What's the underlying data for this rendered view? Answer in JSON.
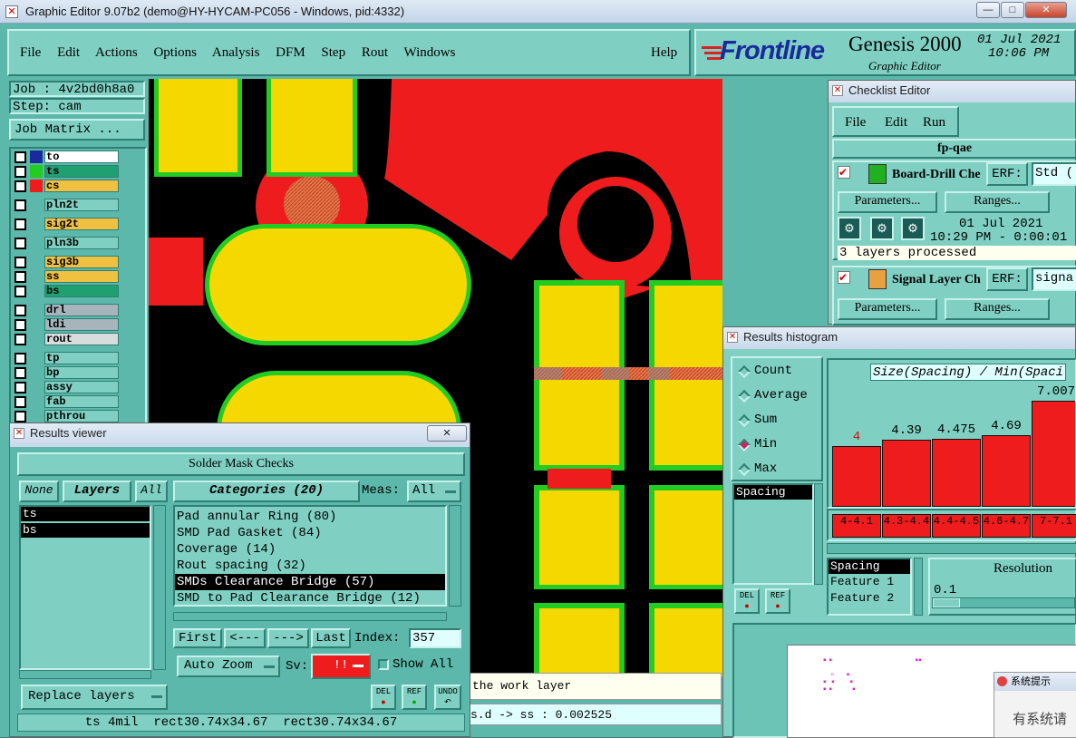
{
  "window": {
    "title": "Graphic Editor 9.07b2 (demo@HY-HYCAM-PC056 - Windows, pid:4332)",
    "minimize": "—",
    "maximize": "□",
    "close": "✕"
  },
  "menubar": {
    "file": "File",
    "edit": "Edit",
    "actions": "Actions",
    "options": "Options",
    "analysis": "Analysis",
    "dfm": "DFM",
    "step": "Step",
    "rout": "Rout",
    "windows": "Windows",
    "help": "Help"
  },
  "brand": {
    "logo": "Frontline",
    "product": "Genesis 2000",
    "subtitle": "Graphic Editor",
    "date": "01 Jul 2021",
    "time": "10:06 PM"
  },
  "job": {
    "job_label": "Job : 4v2bd0h8a0",
    "step_label": "Step: cam",
    "matrix_button": "Job Matrix ..."
  },
  "layers": [
    {
      "name": "to",
      "color": "#ffffff"
    },
    {
      "name": "ts",
      "color": "#20a070"
    },
    {
      "name": "cs",
      "color": "#f0c040"
    },
    {
      "name": "pln2t",
      "color": "#7fd0c3"
    },
    {
      "name": "sig2t",
      "color": "#f0c040"
    },
    {
      "name": "pln3b",
      "color": "#7fd0c3"
    },
    {
      "name": "sig3b",
      "color": "#f0c040"
    },
    {
      "name": "ss",
      "color": "#f0c040"
    },
    {
      "name": "bs",
      "color": "#20a070"
    },
    {
      "name": "drl",
      "color": "#a8b4bc"
    },
    {
      "name": "ldi",
      "color": "#a8b4bc"
    },
    {
      "name": "rout",
      "color": "#d8dcdc"
    },
    {
      "name": "tp",
      "color": "#7fd0c3"
    },
    {
      "name": "bp",
      "color": "#7fd0c3"
    },
    {
      "name": "assy",
      "color": "#7fd0c3"
    },
    {
      "name": "fab",
      "color": "#7fd0c3"
    },
    {
      "name": "pthrou",
      "color": "#7fd0c3"
    }
  ],
  "checklist": {
    "title": "Checklist Editor",
    "menu_file": "File",
    "menu_edit": "Edit",
    "menu_run": "Run",
    "name": "fp-qae",
    "item1": {
      "label": "Board-Drill Che",
      "erf": "ERF:",
      "erf_value": "Std (",
      "params": "Parameters...",
      "ranges": "Ranges...",
      "date": "01 Jul 2021",
      "time": "10:29 PM - 0:00:01",
      "status": "3 layers processed"
    },
    "item2": {
      "label": "Signal Layer Ch",
      "erf": "ERF:",
      "erf_value": "signa",
      "params": "Parameters...",
      "ranges": "Ranges..."
    }
  },
  "results_viewer": {
    "title": "Results viewer",
    "header": "Solder Mask Checks",
    "none": "None",
    "layers_btn": "Layers",
    "all": "All",
    "categories_btn": "Categories (20)",
    "meas_label": "Meas:",
    "meas_value": "All",
    "layers": [
      "ts",
      "bs"
    ],
    "categories": [
      "Pad annular Ring (80)",
      "SMD Pad Gasket (84)",
      "Coverage (14)",
      "Rout spacing (32)",
      "SMDs Clearance Bridge (57)",
      "SMD to Pad Clearance Bridge (12)"
    ],
    "first": "First",
    "prev": "<---",
    "next": "--->",
    "last": "Last",
    "index_label": "Index:",
    "index_value": "357",
    "auto_zoom": "Auto Zoom",
    "sv_label": "Sv:",
    "sv_value": "!!",
    "show_all": "Show All",
    "replace_layers": "Replace layers",
    "del": "DEL",
    "ref": "REF",
    "undo": "UNDO",
    "status": "ts 4mil  rect30.74x34.67  rect30.74x34.67"
  },
  "histogram": {
    "title": "Results histogram",
    "count": "Count",
    "average": "Average",
    "sum": "Sum",
    "min": "Min",
    "max": "Max",
    "chart_title": "Size(Spacing) / Min(Spaci",
    "list": [
      "Spacing"
    ],
    "list2": [
      "Spacing",
      "Feature 1",
      "Feature 2"
    ],
    "resolution_label": "Resolution",
    "resolution_value": "0.1",
    "del": "DEL",
    "ref": "REF"
  },
  "chart_data": {
    "type": "bar",
    "title": "Size(Spacing) / Min(Spaci",
    "categories": [
      "4-4.1",
      "4.3-4.4",
      "4.4-4.5",
      "4.6-4.7",
      "7-7.1"
    ],
    "values": [
      4,
      4.39,
      4.475,
      4.69,
      7.007
    ],
    "value_labels": [
      "4",
      "4.39",
      "4.475",
      "4.69",
      "7.007"
    ]
  },
  "canvas": {
    "prompt": "the work layer",
    "coord_readout": "s.d -> ss : 0.002525"
  },
  "popup": {
    "title": "系统提示",
    "text": "有系统请"
  }
}
